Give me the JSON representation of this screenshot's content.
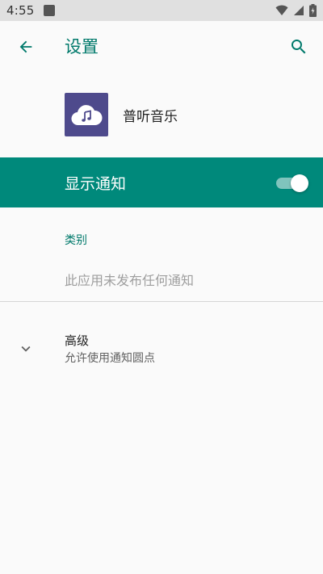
{
  "status_bar": {
    "time": "4:55",
    "icons": [
      "notification-square-icon",
      "wifi-icon",
      "signal-icon",
      "battery-charging-icon"
    ]
  },
  "app_bar": {
    "title": "设置",
    "back_icon": "arrow-left-icon",
    "search_icon": "search-icon"
  },
  "app_header": {
    "name": "普听音乐",
    "icon": "music-cloud-icon",
    "icon_color": "#4e4a8c"
  },
  "notifications": {
    "label": "显示通知",
    "enabled": true,
    "bar_color": "#00897b"
  },
  "category": {
    "header": "类别",
    "empty_text": "此应用未发布任何通知"
  },
  "advanced": {
    "title": "高级",
    "summary": "允许使用通知圆点",
    "icon": "chevron-down-icon"
  },
  "colors": {
    "accent": "#00796b",
    "background": "#fafafa"
  }
}
